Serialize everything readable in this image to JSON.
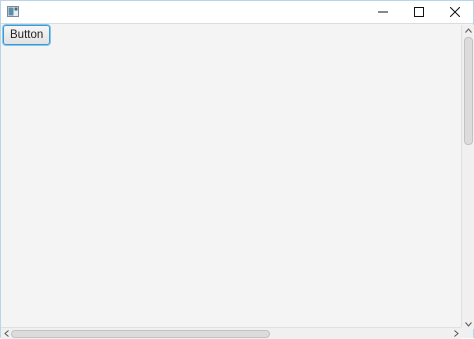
{
  "titlebar": {
    "icon": "java-app-icon",
    "controls": [
      "minimize-icon",
      "maximize-icon",
      "close-icon"
    ]
  },
  "content": {
    "button_label": "Button"
  },
  "scrollbars": {
    "vertical": "vertical-scrollbar",
    "horizontal": "horizontal-scrollbar"
  }
}
